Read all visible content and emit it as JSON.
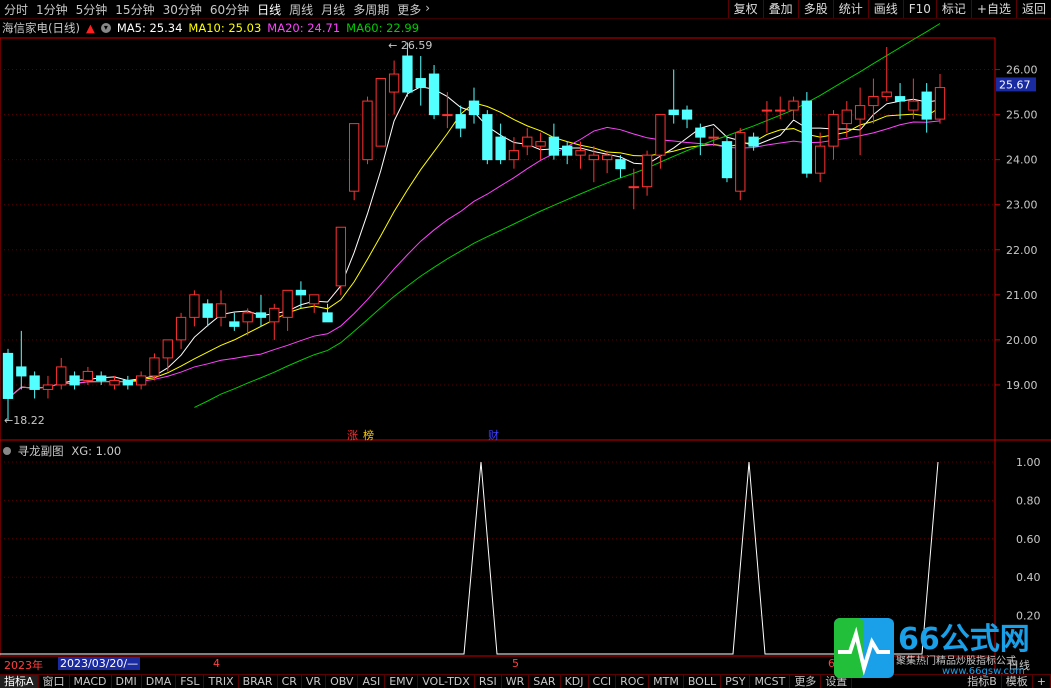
{
  "periods": [
    "分时",
    "1分钟",
    "5分钟",
    "15分钟",
    "30分钟",
    "60分钟",
    "日线",
    "周线",
    "月线",
    "多周期",
    "更多"
  ],
  "active_period": "日线",
  "tools": [
    "复权",
    "叠加",
    "多股",
    "统计",
    "画线",
    "F10",
    "标记",
    "+自选",
    "返回"
  ],
  "stock": {
    "name": "海信家电(日线)"
  },
  "ma": [
    {
      "label": "MA5: 25.34",
      "color": "#ffffff"
    },
    {
      "label": "MA10: 25.03",
      "color": "#ffff00"
    },
    {
      "label": "MA20: 24.71",
      "color": "#ff44ff"
    },
    {
      "label": "MA60: 22.99",
      "color": "#00cc00"
    }
  ],
  "price_axis": [
    "26.00",
    "25.00",
    "24.00",
    "23.00",
    "22.00",
    "21.00",
    "20.00",
    "19.00"
  ],
  "current_price": "25.67",
  "high_label": "26.59",
  "low_label": "18.22",
  "event_tags": [
    "涨",
    "榜",
    "财"
  ],
  "indicator": {
    "title": "寻龙副图",
    "value_label": "XG: 1.00",
    "axis": [
      "1.00",
      "0.80",
      "0.60",
      "0.40",
      "0.20"
    ]
  },
  "dates": {
    "year": "2023年",
    "cursor_date": "2023/03/20/—",
    "months": [
      "4",
      "5",
      "6"
    ],
    "bottom_right": "日线"
  },
  "bottom_tabs": [
    "指标A",
    "窗口",
    "MACD",
    "DMI",
    "DMA",
    "FSL",
    "TRIX",
    "BRAR",
    "CR",
    "VR",
    "OBV",
    "ASI",
    "EMV",
    "VOL-TDX",
    "RSI",
    "WR",
    "SAR",
    "KDJ",
    "CCI",
    "ROC",
    "MTM",
    "BOLL",
    "PSY",
    "MCST",
    "更多",
    "设置"
  ],
  "bottom_right_tabs": [
    "指标B",
    "模板",
    "+"
  ],
  "watermark": {
    "brand": "66公式网",
    "slogan": "聚集热门精品炒股指标公式",
    "url": "www.66gsw.com"
  },
  "colors": {
    "up": "#ff3232",
    "down": "#54ffff",
    "grid": "#5a0000",
    "axis": "#c80000"
  },
  "chart_data": {
    "type": "candlestick",
    "title": "海信家电(日线)",
    "ylim": [
      18.0,
      26.7
    ],
    "candles": [
      [
        19.7,
        18.7,
        19.8,
        18.2
      ],
      [
        19.4,
        19.2,
        20.2,
        18.9
      ],
      [
        19.2,
        18.9,
        19.3,
        18.7
      ],
      [
        18.9,
        19.0,
        19.2,
        18.7
      ],
      [
        19.0,
        19.4,
        19.6,
        18.9
      ],
      [
        19.2,
        19.0,
        19.3,
        18.9
      ],
      [
        19.1,
        19.3,
        19.4,
        19.0
      ],
      [
        19.2,
        19.1,
        19.3,
        19.0
      ],
      [
        19.0,
        19.1,
        19.2,
        18.9
      ],
      [
        19.1,
        19.0,
        19.2,
        18.9
      ],
      [
        19.0,
        19.2,
        19.3,
        18.9
      ],
      [
        19.2,
        19.6,
        19.7,
        19.1
      ],
      [
        19.6,
        20.0,
        20.0,
        19.3
      ],
      [
        20.0,
        20.5,
        20.6,
        19.8
      ],
      [
        20.5,
        21.0,
        21.1,
        20.3
      ],
      [
        20.8,
        20.5,
        20.9,
        20.3
      ],
      [
        20.5,
        20.8,
        21.1,
        20.3
      ],
      [
        20.4,
        20.3,
        20.6,
        20.2
      ],
      [
        20.4,
        20.6,
        20.7,
        20.1
      ],
      [
        20.6,
        20.5,
        21.0,
        20.3
      ],
      [
        20.4,
        20.7,
        20.8,
        20.0
      ],
      [
        20.5,
        21.1,
        21.1,
        20.2
      ],
      [
        21.1,
        21.0,
        21.3,
        20.7
      ],
      [
        20.8,
        21.0,
        21.0,
        20.6
      ],
      [
        20.6,
        20.4,
        20.8,
        20.4
      ],
      [
        21.2,
        22.5,
        22.5,
        21.0
      ],
      [
        23.3,
        24.8,
        24.8,
        23.1
      ],
      [
        24.0,
        25.3,
        25.4,
        23.9
      ],
      [
        24.3,
        25.8,
        25.8,
        24.3
      ],
      [
        25.5,
        25.9,
        26.2,
        25.0
      ],
      [
        26.3,
        25.5,
        26.6,
        25.4
      ],
      [
        25.8,
        25.6,
        26.3,
        25.2
      ],
      [
        25.9,
        25.0,
        26.1,
        24.9
      ],
      [
        25.0,
        25.0,
        25.5,
        24.7
      ],
      [
        25.0,
        24.7,
        25.2,
        24.5
      ],
      [
        25.3,
        25.0,
        25.6,
        24.8
      ],
      [
        25.0,
        24.0,
        25.1,
        23.9
      ],
      [
        24.5,
        24.0,
        24.8,
        23.9
      ],
      [
        24.0,
        24.2,
        24.5,
        23.8
      ],
      [
        24.3,
        24.5,
        24.7,
        24.1
      ],
      [
        24.3,
        24.4,
        24.6,
        24.0
      ],
      [
        24.5,
        24.1,
        24.8,
        24.0
      ],
      [
        24.3,
        24.1,
        24.4,
        23.9
      ],
      [
        24.1,
        24.2,
        24.4,
        23.8
      ],
      [
        24.0,
        24.1,
        24.3,
        23.5
      ],
      [
        24.0,
        24.1,
        24.2,
        23.7
      ],
      [
        24.0,
        23.8,
        24.1,
        23.6
      ],
      [
        23.4,
        23.4,
        23.8,
        22.9
      ],
      [
        23.4,
        24.1,
        24.2,
        23.2
      ],
      [
        24.1,
        25.0,
        25.0,
        23.8
      ],
      [
        25.1,
        25.0,
        26.0,
        24.8
      ],
      [
        25.1,
        24.9,
        25.2,
        24.7
      ],
      [
        24.7,
        24.5,
        24.8,
        24.1
      ],
      [
        24.5,
        24.5,
        24.7,
        24.3
      ],
      [
        24.4,
        23.6,
        24.5,
        23.5
      ],
      [
        23.3,
        24.6,
        24.7,
        23.1
      ],
      [
        24.5,
        24.3,
        24.6,
        24.2
      ],
      [
        25.1,
        25.1,
        25.3,
        24.6
      ],
      [
        25.1,
        25.1,
        25.4,
        24.9
      ],
      [
        25.1,
        25.3,
        25.4,
        24.9
      ],
      [
        25.3,
        23.7,
        25.5,
        23.6
      ],
      [
        23.7,
        24.3,
        24.6,
        23.5
      ],
      [
        24.3,
        25.0,
        25.1,
        24.0
      ],
      [
        24.8,
        25.1,
        25.3,
        24.5
      ],
      [
        24.9,
        25.2,
        25.6,
        24.1
      ],
      [
        25.2,
        25.4,
        25.8,
        24.8
      ],
      [
        25.4,
        25.5,
        26.5,
        25.3
      ],
      [
        25.4,
        25.3,
        25.7,
        24.9
      ],
      [
        25.1,
        25.3,
        25.8,
        24.9
      ],
      [
        25.5,
        24.9,
        25.7,
        24.6
      ],
      [
        24.9,
        25.6,
        25.9,
        24.8
      ]
    ],
    "indicator_peaks": [
      0.0,
      1.0,
      0.0,
      1.0,
      0.0,
      1.0
    ]
  }
}
